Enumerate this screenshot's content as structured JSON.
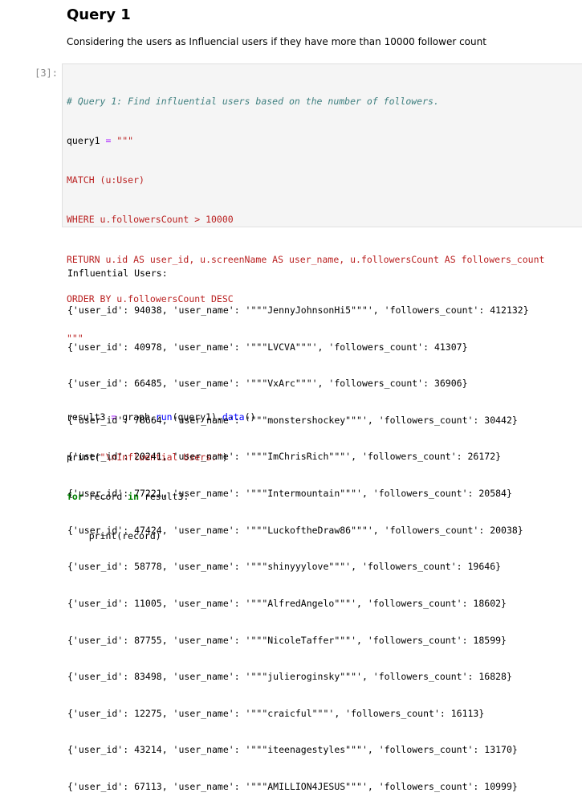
{
  "markdown": {
    "heading": "Query 1",
    "text": "Considering the users as Influencial users if they have more than 10000 follower count"
  },
  "cell": {
    "prompt": "[3]:",
    "code": {
      "comment": "# Query 1: Find influential users based on the number of followers.",
      "q_var": "query1",
      "assign": " = ",
      "triple_open": "\"\"\"",
      "cypher_1": "MATCH (u:User)",
      "cypher_2": "WHERE u.followersCount > 10000",
      "cypher_3": "RETURN u.id AS user_id, u.screenName AS user_name, u.followersCount AS followers_count",
      "cypher_4": "ORDER BY u.followersCount DESC",
      "triple_close": "\"\"\"",
      "l9_a": "result3",
      "l9_b": " = ",
      "l9_c": "graph.",
      "l9_d": "run",
      "l9_e": "(query1).",
      "l9_f": "data",
      "l9_g": "()",
      "l10_a": "print(",
      "l10_b": "\"\\nInfluential Users:\"",
      "l10_c": ")",
      "l11_a": "for",
      "l11_b": " record ",
      "l11_c": "in",
      "l11_d": " result3:",
      "l12": "    print(record)"
    }
  },
  "output": {
    "header": "Influential Users:",
    "records": [
      "{'user_id': 94038, 'user_name': '\"\"\"JennyJohnsonHi5\"\"\"', 'followers_count': 412132}",
      "{'user_id': 40978, 'user_name': '\"\"\"LVCVA\"\"\"', 'followers_count': 41307}",
      "{'user_id': 66485, 'user_name': '\"\"\"VxArc\"\"\"', 'followers_count': 36906}",
      "{'user_id': 78664, 'user_name': '\"\"\"monstershockey\"\"\"', 'followers_count': 30442}",
      "{'user_id': 20241, 'user_name': '\"\"\"ImChrisRich\"\"\"', 'followers_count': 26172}",
      "{'user_id': 77221, 'user_name': '\"\"\"Intermountain\"\"\"', 'followers_count': 20584}",
      "{'user_id': 47424, 'user_name': '\"\"\"LuckoftheDraw86\"\"\"', 'followers_count': 20038}",
      "{'user_id': 58778, 'user_name': '\"\"\"shinyyylove\"\"\"', 'followers_count': 19646}",
      "{'user_id': 11005, 'user_name': '\"\"\"AlfredAngelo\"\"\"', 'followers_count': 18602}",
      "{'user_id': 87755, 'user_name': '\"\"\"NicoleTaffer\"\"\"', 'followers_count': 18599}",
      "{'user_id': 83498, 'user_name': '\"\"\"julieroginsky\"\"\"', 'followers_count': 16828}",
      "{'user_id': 12275, 'user_name': '\"\"\"craicful\"\"\"', 'followers_count': 16113}",
      "{'user_id': 43214, 'user_name': '\"\"\"iteenagestyles\"\"\"', 'followers_count': 13170}",
      "{'user_id': 67113, 'user_name': '\"\"\"AMILLION4JESUS\"\"\"', 'followers_count': 10999}"
    ]
  }
}
